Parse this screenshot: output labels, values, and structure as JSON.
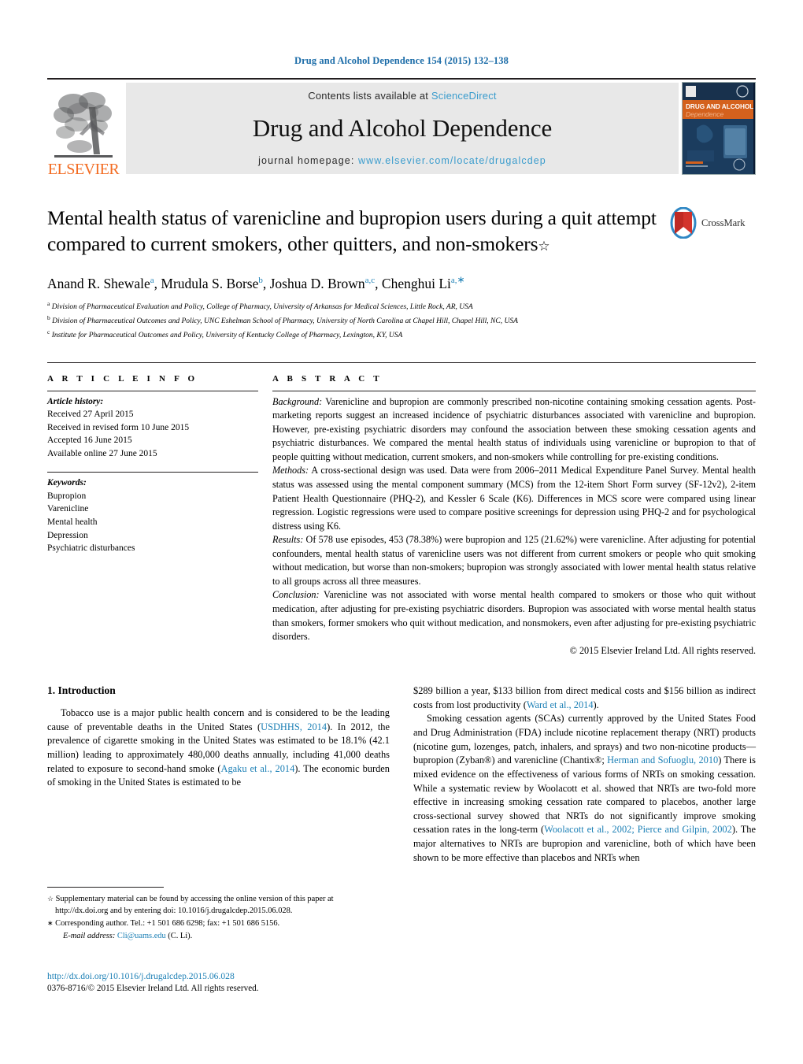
{
  "running_head": "Drug and Alcohol Dependence 154 (2015) 132–138",
  "masthead": {
    "contents_prefix": "Contents lists available at ",
    "contents_link": "ScienceDirect",
    "journal_name": "Drug and Alcohol Dependence",
    "homepage_prefix": "journal homepage: ",
    "homepage_url": "www.elsevier.com/locate/drugalcdep",
    "publisher": "ELSEVIER",
    "cover_title_line1": "DRUG AND ALCOHOL",
    "cover_title_line2": "Dependence"
  },
  "title": {
    "text": "Mental health status of varenicline and bupropion users during a quit attempt compared to current smokers, other quitters, and non-smokers",
    "footnote_mark": "☆",
    "crossmark_label": "CrossMark"
  },
  "authors": {
    "list": "Anand R. Shewale , Mrudula S. Borse , Joshua D. Brown , Chenghui Li",
    "affiliations": [
      {
        "mark": "a",
        "text": "Division of Pharmaceutical Evaluation and Policy, College of Pharmacy, University of Arkansas for Medical Sciences, Little Rock, AR, USA"
      },
      {
        "mark": "b",
        "text": "Division of Pharmaceutical Outcomes and Policy, UNC Eshelman School of Pharmacy, University of North Carolina at Chapel Hill, Chapel Hill, NC, USA"
      },
      {
        "mark": "c",
        "text": "Institute for Pharmaceutical Outcomes and Policy, University of Kentucky College of Pharmacy, Lexington, KY, USA"
      }
    ]
  },
  "article_info": {
    "heading": "A R T I C L E  I N F O",
    "history_label": "Article history:",
    "history": [
      "Received 27 April 2015",
      "Received in revised form 10 June 2015",
      "Accepted 16 June 2015",
      "Available online 27 June 2015"
    ],
    "keywords_label": "Keywords:",
    "keywords": [
      "Bupropion",
      "Varenicline",
      "Mental health",
      "Depression",
      "Psychiatric disturbances"
    ]
  },
  "abstract": {
    "heading": "A B S T R A C T",
    "background_label": "Background:",
    "background": " Varenicline and bupropion are commonly prescribed non-nicotine containing smoking cessation agents. Post-marketing reports suggest an increased incidence of psychiatric disturbances associated with varenicline and bupropion. However, pre-existing psychiatric disorders may confound the association between these smoking cessation agents and psychiatric disturbances. We compared the mental health status of individuals using varenicline or bupropion to that of people quitting without medication, current smokers, and non-smokers while controlling for pre-existing conditions.",
    "methods_label": "Methods:",
    "methods": " A cross-sectional design was used. Data were from 2006–2011 Medical Expenditure Panel Survey. Mental health status was assessed using the mental component summary (MCS) from the 12-item Short Form survey (SF-12v2), 2-item Patient Health Questionnaire (PHQ-2), and Kessler 6 Scale (K6). Differences in MCS score were compared using linear regression. Logistic regressions were used to compare positive screenings for depression using PHQ-2 and for psychological distress using K6.",
    "results_label": "Results:",
    "results": " Of 578 use episodes, 453 (78.38%) were bupropion and 125 (21.62%) were varenicline. After adjusting for potential confounders, mental health status of varenicline users was not different from current smokers or people who quit smoking without medication, but worse than non-smokers; bupropion was strongly associated with lower mental health status relative to all groups across all three measures.",
    "conclusion_label": "Conclusion:",
    "conclusion": " Varenicline was not associated with worse mental health compared to smokers or those who quit without medication, after adjusting for pre-existing psychiatric disorders. Bupropion was associated with worse mental health status than smokers, former smokers who quit without medication, and nonsmokers, even after adjusting for pre-existing psychiatric disorders.",
    "copyright": "© 2015 Elsevier Ireland Ltd. All rights reserved."
  },
  "introduction": {
    "heading": "1. Introduction",
    "left_p1_a": "Tobacco use is a major public health concern and is considered to be the leading cause of preventable deaths in the United States (",
    "left_ref1": "USDHHS, 2014",
    "left_p1_b": "). In 2012, the prevalence of cigarette smoking in the United States was estimated to be 18.1% (42.1 million) leading to approximately 480,000 deaths annually, including 41,000 deaths related to exposure to second-hand smoke (",
    "left_ref2": "Agaku et al., 2014",
    "left_p1_c": "). The economic burden of smoking in the United States is estimated to be",
    "right_p1_a": "$289 billion a year, $133 billion from direct medical costs and $156 billion as indirect costs from lost productivity (",
    "right_ref1": "Ward et al., 2014",
    "right_p1_b": ").",
    "right_p2_a": "Smoking cessation agents (SCAs) currently approved by the United States Food and Drug Administration (FDA) include nicotine replacement therapy (NRT) products (nicotine gum, lozenges, patch, inhalers, and sprays) and two non-nicotine products—bupropion (Zyban®) and varenicline (Chantix®; ",
    "right_ref2": "Herman and Sofuoglu, 2010",
    "right_p2_b": ") There is mixed evidence on the effectiveness of various forms of NRTs on smoking cessation. While a systematic review by Woolacott et al. showed that NRTs are two-fold more effective in increasing smoking cessation rate compared to placebos, another large cross-sectional survey showed that NRTs do not significantly improve smoking cessation rates in the long-term (",
    "right_ref3": "Woolacott et al., 2002; Pierce and Gilpin, 2002",
    "right_p2_c": "). The major alternatives to NRTs are bupropion and varenicline, both of which have been shown to be more effective than placebos and NRTs when"
  },
  "footnotes": {
    "supp_mark": "☆",
    "supp_text": " Supplementary material can be found by accessing the online version of this paper at http://dx.doi.org and by entering doi: 10.1016/j.drugalcdep.2015.06.028.",
    "corr_mark": "∗",
    "corr_text": " Corresponding author. Tel.: +1 501 686 6298; fax: +1 501 686 5156.",
    "email_label": "E-mail address:",
    "email": "Cli@uams.edu",
    "email_suffix": " (C. Li)."
  },
  "footer": {
    "doi_url": "http://dx.doi.org/10.1016/j.drugalcdep.2015.06.028",
    "issn_line": "0376-8716/© 2015 Elsevier Ireland Ltd. All rights reserved."
  },
  "colors": {
    "link_blue": "#1b7fb5",
    "header_blue": "#1b6ca8",
    "sciencedirect_blue": "#3a9ccd",
    "elsevier_orange": "#F26B21",
    "band_gray": "#e8e8e8"
  }
}
